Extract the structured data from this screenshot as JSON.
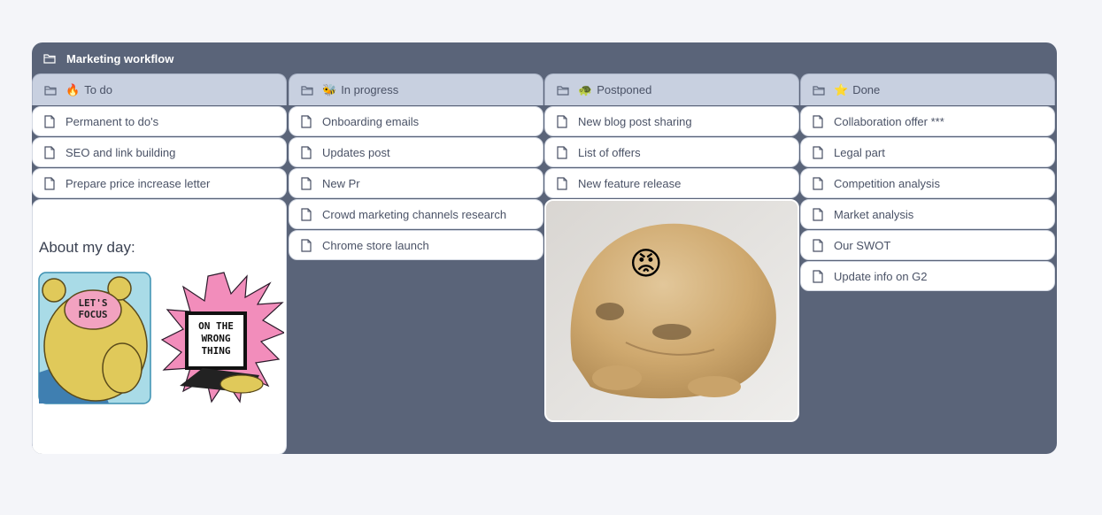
{
  "board": {
    "title": "Marketing workflow",
    "columns": [
      {
        "emoji": "🔥",
        "title": "To do",
        "cards": [
          "Permanent to do's",
          "SEO and link building",
          "Prepare price increase letter"
        ],
        "note": {
          "title": "About my day:",
          "image_text": [
            "LET'S",
            "FOCUS",
            "ON THE",
            "WRONG",
            "THING"
          ]
        }
      },
      {
        "emoji": "🐝",
        "title": "In progress",
        "cards": [
          "Onboarding emails",
          "Updates post",
          "New Pr",
          "Crowd marketing channels research",
          "Chrome store launch"
        ]
      },
      {
        "emoji": "🐢",
        "title": "Postponed",
        "cards": [
          "New blog post sharing",
          "List of offers",
          "New feature release"
        ],
        "image": {
          "emoji": "😡"
        }
      },
      {
        "emoji": "⭐",
        "title": "Done",
        "cards": [
          "Collaboration offer ***",
          "Legal part",
          "Competition analysis",
          "Market analysis",
          "Our SWOT",
          "Update info on G2"
        ]
      }
    ]
  },
  "colors": {
    "board_bg": "#5a6479",
    "column_header_bg": "#c8d0e0",
    "card_bg": "#ffffff",
    "text": "#4a5266"
  },
  "icons": {
    "folder": "folder-icon",
    "document": "document-icon"
  }
}
